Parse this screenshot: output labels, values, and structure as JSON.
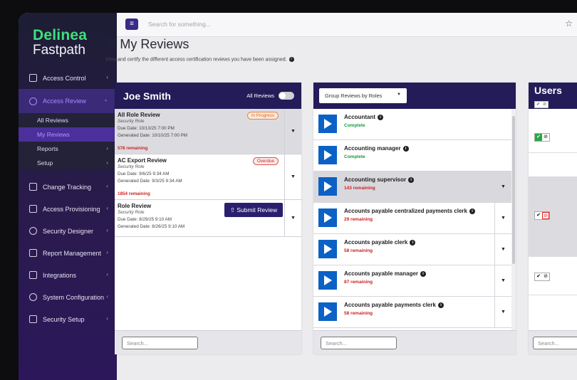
{
  "brand": {
    "line1": "Delinea",
    "line2": "Fastpath"
  },
  "colors": {
    "brand_green": "#3ee07a",
    "nav_dark": "#231c58",
    "accent_purple": "#a98bff",
    "complete_green": "#1a9a3d",
    "remaining_red": "#cc2222"
  },
  "topbar": {
    "search_placeholder": "Search for something..."
  },
  "sidebar": {
    "items": [
      {
        "label": "Access Control",
        "icon": "dashboard-icon"
      },
      {
        "label": "Access Review",
        "icon": "check-circle-icon"
      },
      {
        "label": "Change Tracking",
        "icon": "calendar-icon"
      },
      {
        "label": "Access Provisioning",
        "icon": "id-card-icon"
      },
      {
        "label": "Security Designer",
        "icon": "user-shield-icon"
      },
      {
        "label": "Report Management",
        "icon": "report-icon"
      },
      {
        "label": "Integrations",
        "icon": "terminal-icon"
      },
      {
        "label": "System Configuration",
        "icon": "gear-icon"
      },
      {
        "label": "Security Setup",
        "icon": "lock-icon"
      }
    ],
    "sub": [
      "All Reviews",
      "My Reviews",
      "Reports",
      "Setup"
    ]
  },
  "page": {
    "title": "My Reviews",
    "subtitle": "View and certify the different access certification reviews you have been assigned."
  },
  "reviewer": {
    "name": "Joe Smith",
    "toggle_label": "All Reviews",
    "reviews": [
      {
        "title": "All Role Review",
        "type": "Security Role",
        "due": "Due Date: 10/13/25 7:00 PM",
        "generated": "Generated Date: 10/10/25 7:00 PM",
        "remaining": "578 remaining",
        "badge": "In Progress"
      },
      {
        "title": "AC Export Review",
        "type": "Security Role",
        "due": "Due Date: 9/6/25 9:34 AM",
        "generated": "Generated Date: 9/3/25 9:34 AM",
        "remaining": "1854 remaining",
        "badge": "Overdue"
      },
      {
        "title": "Role Review",
        "type": "Security Role",
        "due": "Due Date: 8/29/25 9:10 AM",
        "generated": "Generated Date: 8/26/25 9:10 AM",
        "remaining": "",
        "badge": ""
      }
    ],
    "submit_label": "Submit Review",
    "search_placeholder": "Search..."
  },
  "roles_panel": {
    "group_by": "Group Reviews by Roles",
    "roles": [
      {
        "name": "Accountant",
        "status": "Complete"
      },
      {
        "name": "Accounting manager",
        "status": "Complete"
      },
      {
        "name": "Accounting supervisor",
        "status": "143 remaining"
      },
      {
        "name": "Accounts payable centralized payments clerk",
        "status": "29 remaining"
      },
      {
        "name": "Accounts payable clerk",
        "status": "58 remaining"
      },
      {
        "name": "Accounts payable manager",
        "status": "87 remaining"
      },
      {
        "name": "Accounts payable payments clerk",
        "status": "58 remaining"
      }
    ],
    "search_placeholder": "Search..."
  },
  "users_panel": {
    "title": "Users",
    "search_placeholder": "Search..."
  }
}
